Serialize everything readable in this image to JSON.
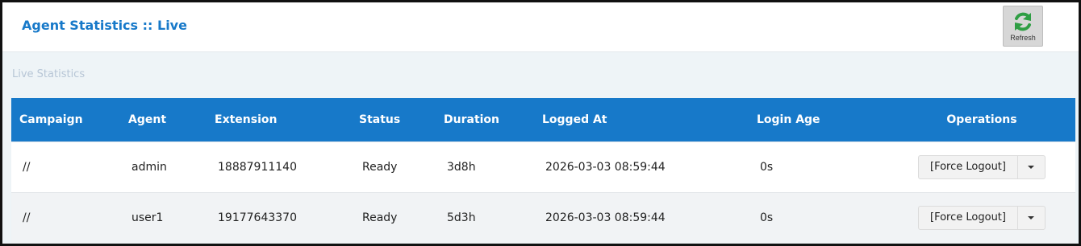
{
  "header": {
    "title": "Agent Statistics :: Live",
    "refresh_label": "Refresh",
    "refresh_icon": "refresh-icon",
    "refresh_color": "#2f9e44"
  },
  "section": {
    "title": "Live Statistics"
  },
  "table": {
    "columns": [
      "Campaign",
      "Agent",
      "Extension",
      "Status",
      "Duration",
      "Logged At",
      "Login Age",
      "Operations"
    ],
    "rows": [
      {
        "campaign": "//",
        "agent": "admin",
        "extension": "18887911140",
        "status": "Ready",
        "duration": "3d8h",
        "logged_at": "2026-03-03 08:59:44",
        "login_age": "0s",
        "operation": "[Force Logout]"
      },
      {
        "campaign": "//",
        "agent": "user1",
        "extension": "19177643370",
        "status": "Ready",
        "duration": "5d3h",
        "logged_at": "2026-03-03 08:59:44",
        "login_age": "0s",
        "operation": "[Force Logout]"
      }
    ]
  },
  "colors": {
    "accent": "#1779c9",
    "header_text": "#ffffff"
  }
}
